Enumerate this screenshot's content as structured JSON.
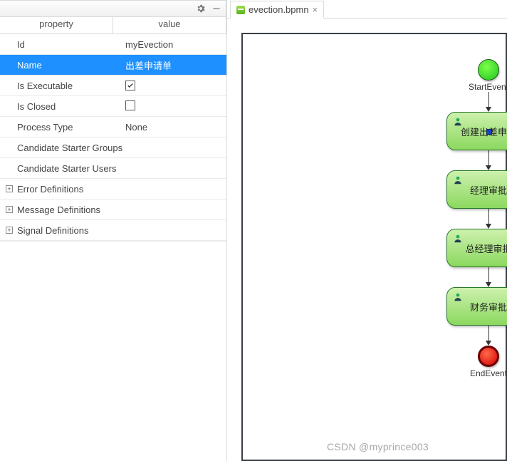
{
  "toolbar": {},
  "property_header": {
    "col1": "property",
    "col2": "value"
  },
  "props": {
    "id": {
      "label": "Id",
      "value": "myEvection"
    },
    "name": {
      "label": "Name",
      "value": "出差申请单"
    },
    "exec": {
      "label": "Is Executable",
      "checked": true
    },
    "closed": {
      "label": "Is Closed",
      "checked": false
    },
    "ptype": {
      "label": "Process Type",
      "value": "None"
    },
    "cgroups": {
      "label": "Candidate Starter Groups",
      "value": ""
    },
    "cusers": {
      "label": "Candidate Starter Users",
      "value": ""
    }
  },
  "trees": {
    "err": "Error Definitions",
    "msg": "Message Definitions",
    "sig": "Signal Definitions"
  },
  "tab": {
    "filename": "evection.bpmn"
  },
  "diagram": {
    "start_label": "StartEvent",
    "end_label": "EndEvent",
    "tasks": [
      "创建出差申请",
      "经理审批",
      "总经理审批",
      "财务审批"
    ],
    "selected_task_index": 0
  },
  "watermark": "CSDN @myprince003"
}
